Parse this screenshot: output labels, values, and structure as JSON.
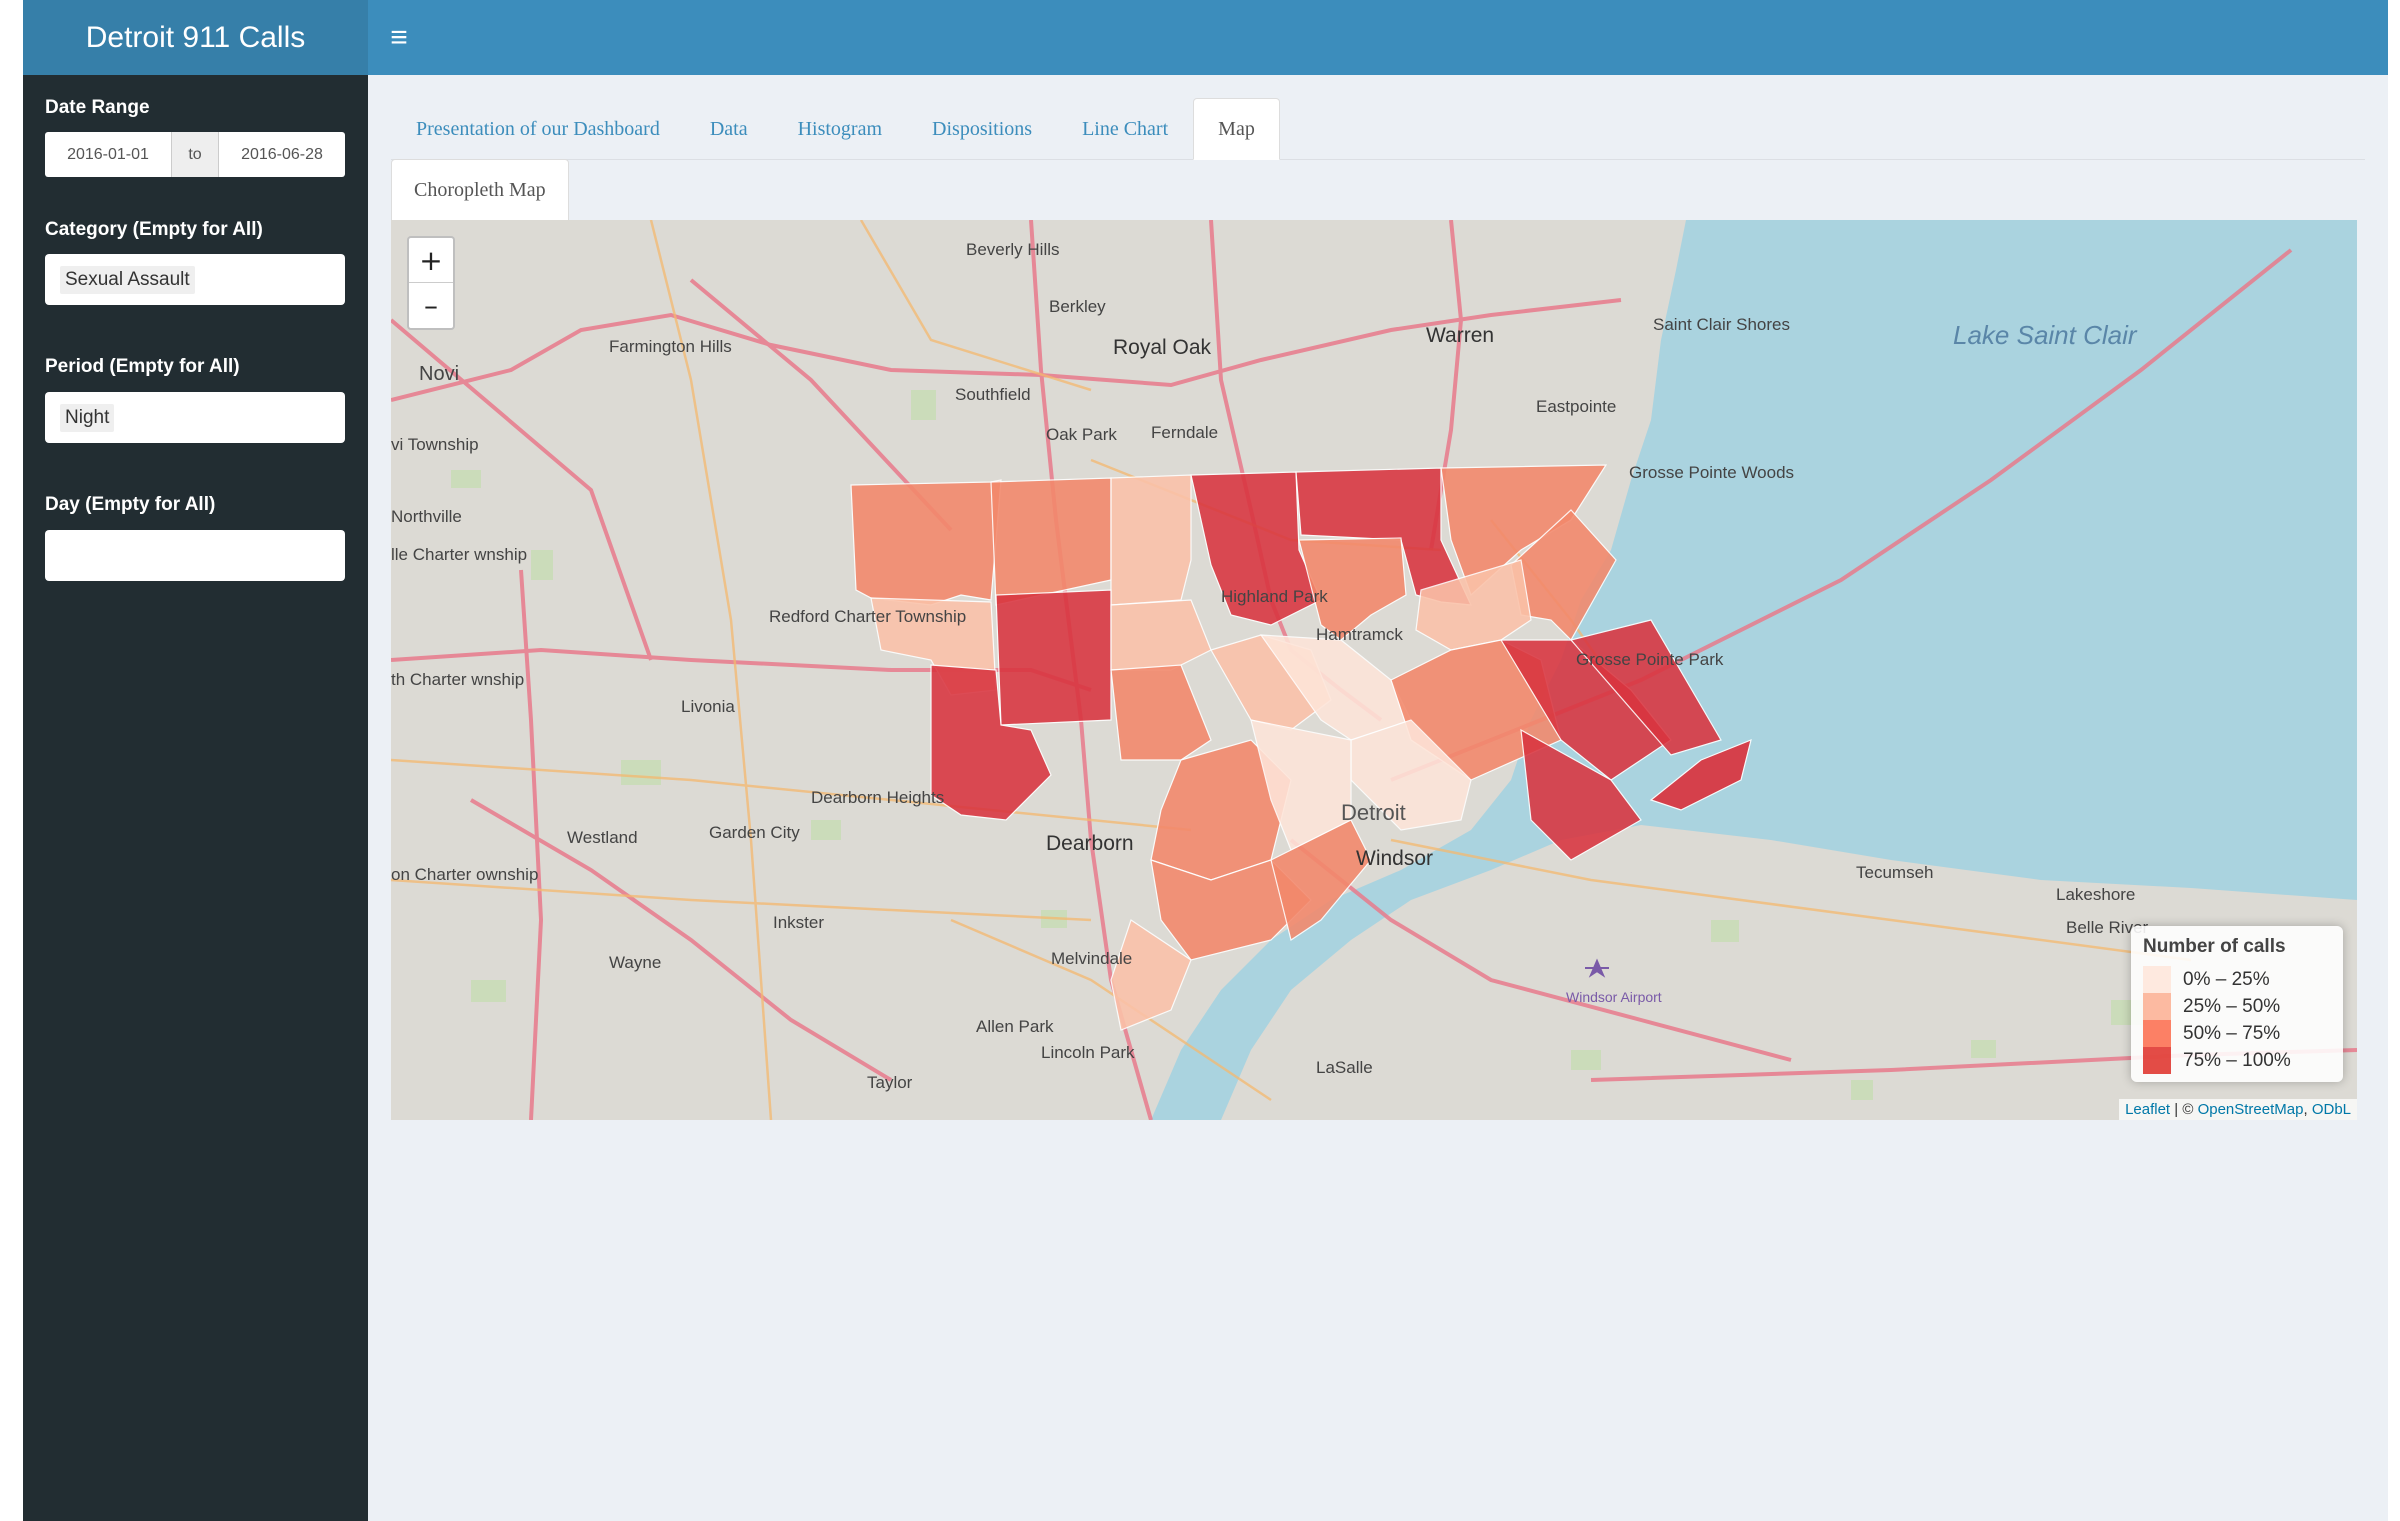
{
  "app": {
    "title": "Detroit 911 Calls",
    "menu_icon": "≡"
  },
  "sidebar": {
    "date_range": {
      "label": "Date Range",
      "start": "2016-01-01",
      "separator": "to",
      "end": "2016-06-28"
    },
    "category": {
      "label": "Category (Empty for All)",
      "selected": "Sexual Assault"
    },
    "period": {
      "label": "Period (Empty for All)",
      "selected": "Night"
    },
    "day": {
      "label": "Day (Empty for All)",
      "selected": ""
    }
  },
  "tabs": [
    {
      "label": "Presentation of our Dashboard",
      "active": false
    },
    {
      "label": "Data",
      "active": false
    },
    {
      "label": "Histogram",
      "active": false
    },
    {
      "label": "Dispositions",
      "active": false
    },
    {
      "label": "Line Chart",
      "active": false
    },
    {
      "label": "Map",
      "active": true
    }
  ],
  "subtabs": [
    {
      "label": "Choropleth Map",
      "active": true
    }
  ],
  "map": {
    "zoom_in": "+",
    "zoom_out": "–",
    "legend": {
      "title": "Number of calls",
      "bins": [
        {
          "label": "0% – 25%",
          "color": "#fee5d9"
        },
        {
          "label": "25% – 50%",
          "color": "#fcae91"
        },
        {
          "label": "50% – 75%",
          "color": "#fb6a4a"
        },
        {
          "label": "75% – 100%",
          "color": "#de2d26"
        }
      ]
    },
    "attribution": {
      "leaflet": "Leaflet",
      "sep": " | © ",
      "osm": "OpenStreetMap",
      "comma": ", ",
      "odbl": "ODbL"
    },
    "places": [
      "Detroit 911 Calls",
      "Beverly Hills",
      "Berkley",
      "Royal Oak",
      "Warren",
      "Saint Clair Shores",
      "Lake Saint Clair",
      "Novi",
      "Farmington Hills",
      "Southfield",
      "Oak Park",
      "Ferndale",
      "Eastpointe",
      "Grosse Pointe Woods",
      "Highland Park",
      "Hamtramck",
      "Redford Charter Township",
      "Livonia",
      "Grosse Pointe Park",
      "Dearborn Heights",
      "Westland",
      "Garden City",
      "Dearborn",
      "Detroit",
      "Windsor",
      "Tecumseh",
      "Lakeshore",
      "Belle River",
      "Inkster",
      "Wayne",
      "Melvindale",
      "Allen Park",
      "Lincoln Park",
      "Taylor",
      "LaSalle",
      "Windsor Airport",
      "Northville",
      "vi Township",
      "lle Charter wnship",
      "th Charter wnship",
      "on Charter ownship"
    ]
  }
}
